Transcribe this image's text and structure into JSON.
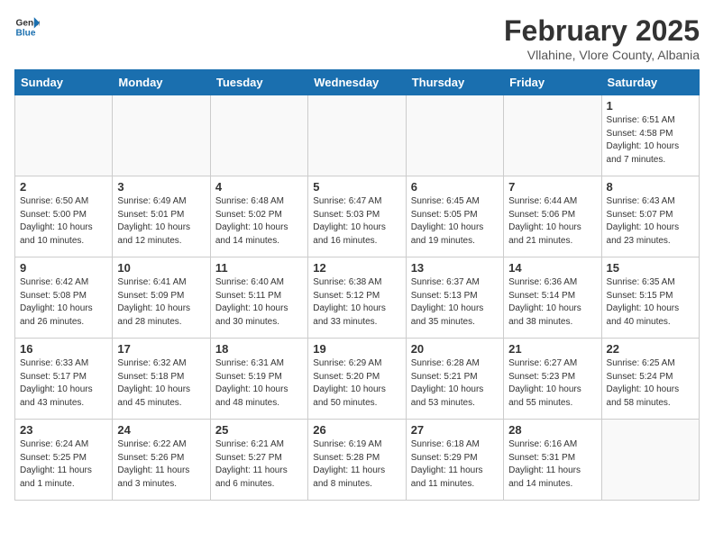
{
  "header": {
    "logo_general": "General",
    "logo_blue": "Blue",
    "month_title": "February 2025",
    "location": "Vllahine, Vlore County, Albania"
  },
  "weekdays": [
    "Sunday",
    "Monday",
    "Tuesday",
    "Wednesday",
    "Thursday",
    "Friday",
    "Saturday"
  ],
  "weeks": [
    [
      {
        "day": "",
        "info": ""
      },
      {
        "day": "",
        "info": ""
      },
      {
        "day": "",
        "info": ""
      },
      {
        "day": "",
        "info": ""
      },
      {
        "day": "",
        "info": ""
      },
      {
        "day": "",
        "info": ""
      },
      {
        "day": "1",
        "info": "Sunrise: 6:51 AM\nSunset: 4:58 PM\nDaylight: 10 hours\nand 7 minutes."
      }
    ],
    [
      {
        "day": "2",
        "info": "Sunrise: 6:50 AM\nSunset: 5:00 PM\nDaylight: 10 hours\nand 10 minutes."
      },
      {
        "day": "3",
        "info": "Sunrise: 6:49 AM\nSunset: 5:01 PM\nDaylight: 10 hours\nand 12 minutes."
      },
      {
        "day": "4",
        "info": "Sunrise: 6:48 AM\nSunset: 5:02 PM\nDaylight: 10 hours\nand 14 minutes."
      },
      {
        "day": "5",
        "info": "Sunrise: 6:47 AM\nSunset: 5:03 PM\nDaylight: 10 hours\nand 16 minutes."
      },
      {
        "day": "6",
        "info": "Sunrise: 6:45 AM\nSunset: 5:05 PM\nDaylight: 10 hours\nand 19 minutes."
      },
      {
        "day": "7",
        "info": "Sunrise: 6:44 AM\nSunset: 5:06 PM\nDaylight: 10 hours\nand 21 minutes."
      },
      {
        "day": "8",
        "info": "Sunrise: 6:43 AM\nSunset: 5:07 PM\nDaylight: 10 hours\nand 23 minutes."
      }
    ],
    [
      {
        "day": "9",
        "info": "Sunrise: 6:42 AM\nSunset: 5:08 PM\nDaylight: 10 hours\nand 26 minutes."
      },
      {
        "day": "10",
        "info": "Sunrise: 6:41 AM\nSunset: 5:09 PM\nDaylight: 10 hours\nand 28 minutes."
      },
      {
        "day": "11",
        "info": "Sunrise: 6:40 AM\nSunset: 5:11 PM\nDaylight: 10 hours\nand 30 minutes."
      },
      {
        "day": "12",
        "info": "Sunrise: 6:38 AM\nSunset: 5:12 PM\nDaylight: 10 hours\nand 33 minutes."
      },
      {
        "day": "13",
        "info": "Sunrise: 6:37 AM\nSunset: 5:13 PM\nDaylight: 10 hours\nand 35 minutes."
      },
      {
        "day": "14",
        "info": "Sunrise: 6:36 AM\nSunset: 5:14 PM\nDaylight: 10 hours\nand 38 minutes."
      },
      {
        "day": "15",
        "info": "Sunrise: 6:35 AM\nSunset: 5:15 PM\nDaylight: 10 hours\nand 40 minutes."
      }
    ],
    [
      {
        "day": "16",
        "info": "Sunrise: 6:33 AM\nSunset: 5:17 PM\nDaylight: 10 hours\nand 43 minutes."
      },
      {
        "day": "17",
        "info": "Sunrise: 6:32 AM\nSunset: 5:18 PM\nDaylight: 10 hours\nand 45 minutes."
      },
      {
        "day": "18",
        "info": "Sunrise: 6:31 AM\nSunset: 5:19 PM\nDaylight: 10 hours\nand 48 minutes."
      },
      {
        "day": "19",
        "info": "Sunrise: 6:29 AM\nSunset: 5:20 PM\nDaylight: 10 hours\nand 50 minutes."
      },
      {
        "day": "20",
        "info": "Sunrise: 6:28 AM\nSunset: 5:21 PM\nDaylight: 10 hours\nand 53 minutes."
      },
      {
        "day": "21",
        "info": "Sunrise: 6:27 AM\nSunset: 5:23 PM\nDaylight: 10 hours\nand 55 minutes."
      },
      {
        "day": "22",
        "info": "Sunrise: 6:25 AM\nSunset: 5:24 PM\nDaylight: 10 hours\nand 58 minutes."
      }
    ],
    [
      {
        "day": "23",
        "info": "Sunrise: 6:24 AM\nSunset: 5:25 PM\nDaylight: 11 hours\nand 1 minute."
      },
      {
        "day": "24",
        "info": "Sunrise: 6:22 AM\nSunset: 5:26 PM\nDaylight: 11 hours\nand 3 minutes."
      },
      {
        "day": "25",
        "info": "Sunrise: 6:21 AM\nSunset: 5:27 PM\nDaylight: 11 hours\nand 6 minutes."
      },
      {
        "day": "26",
        "info": "Sunrise: 6:19 AM\nSunset: 5:28 PM\nDaylight: 11 hours\nand 8 minutes."
      },
      {
        "day": "27",
        "info": "Sunrise: 6:18 AM\nSunset: 5:29 PM\nDaylight: 11 hours\nand 11 minutes."
      },
      {
        "day": "28",
        "info": "Sunrise: 6:16 AM\nSunset: 5:31 PM\nDaylight: 11 hours\nand 14 minutes."
      },
      {
        "day": "",
        "info": ""
      }
    ]
  ]
}
